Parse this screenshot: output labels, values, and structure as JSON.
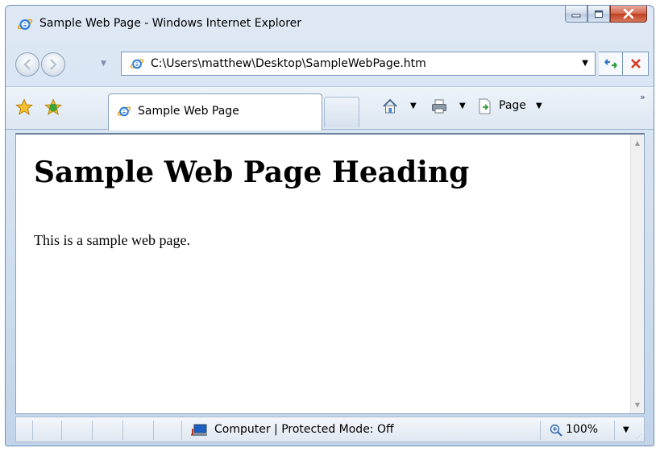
{
  "window": {
    "title": "Sample Web Page - Windows Internet Explorer",
    "controls": {
      "minimize_icon": "minimize-icon",
      "maximize_icon": "maximize-icon",
      "close_icon": "close-icon"
    }
  },
  "navigation": {
    "address": "C:\\Users\\matthew\\Desktop\\SampleWebPage.htm",
    "dropdown_glyph": "▼"
  },
  "tabs": [
    {
      "label": "Sample Web Page",
      "icon": "ie-page-icon",
      "active": true
    }
  ],
  "command_bar": {
    "page_label": "Page",
    "dropdown_glyph": "▼",
    "overflow_glyph": "»"
  },
  "content": {
    "heading": "Sample Web Page Heading",
    "paragraph": "This is a sample web page."
  },
  "status_bar": {
    "zone_text": "Computer | Protected Mode: Off",
    "zoom": "100%",
    "dropdown_glyph": "▼"
  },
  "colors": {
    "chrome": "#cfdeef",
    "close_button": "#c0401f",
    "ie_blue": "#1f6fd1",
    "favorites_star": "#f2b51d"
  }
}
